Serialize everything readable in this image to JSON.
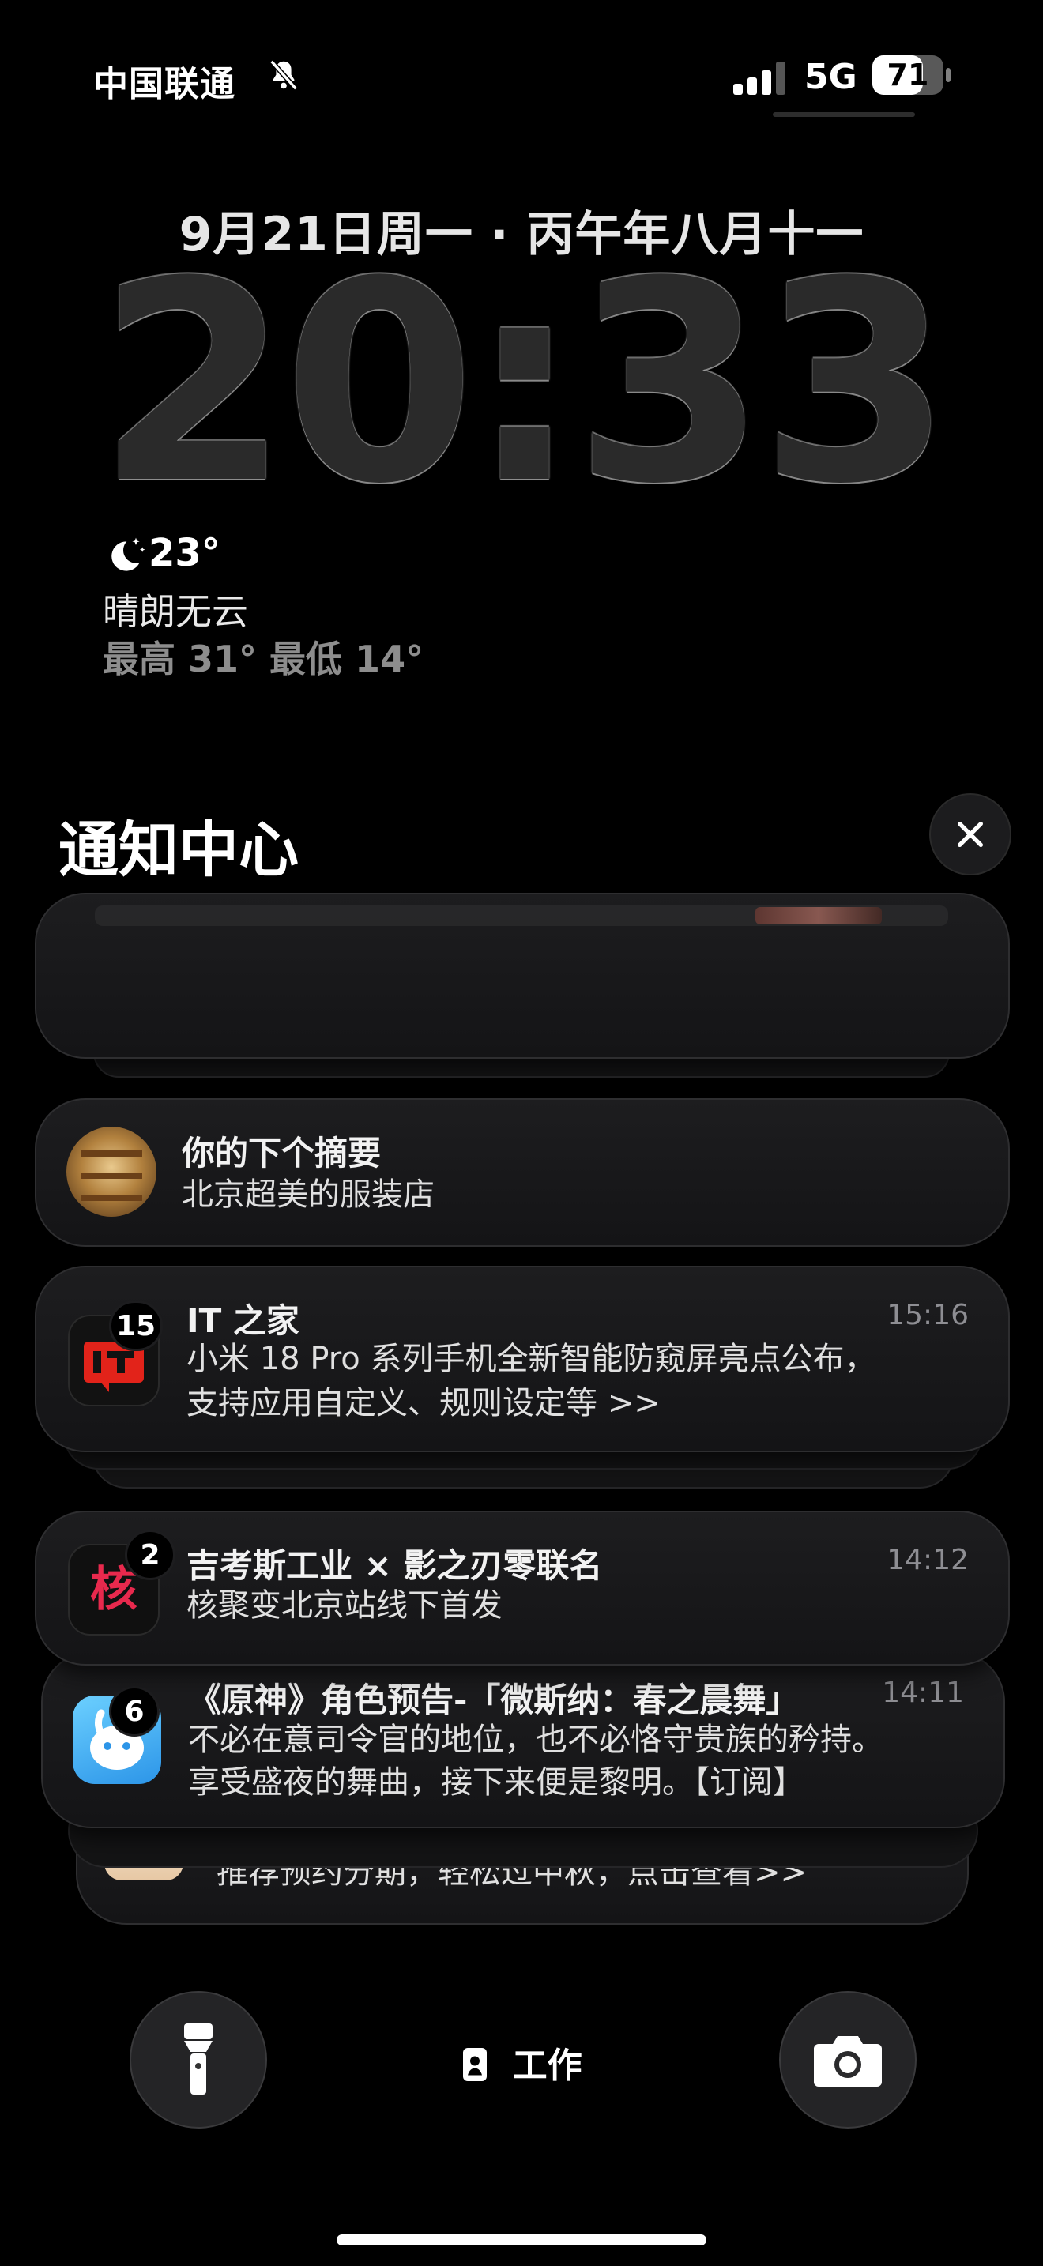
{
  "status": {
    "carrier": "中国联通",
    "network": "5G",
    "battery": "71"
  },
  "lockscreen": {
    "date": "9月21日周一 · 丙午年八月十一",
    "time": "20:33",
    "weather": {
      "temp": "23°",
      "condition": "晴朗无云",
      "range": "最高 31° 最低 14°"
    }
  },
  "notification_center": {
    "title": "通知中心",
    "notifications": [
      {
        "title": "你的下个摘要",
        "body": "北京超美的服装店"
      },
      {
        "app": "IT 之家",
        "badge": "15",
        "time": "15:16",
        "body_line1": "小米 18 Pro 系列手机全新智能防窥屏亮点公布，",
        "body_line2": "支持应用自定义、规则设定等 >>"
      },
      {
        "title": "吉考斯工业 × 影之刃零联名",
        "badge": "2",
        "time": "14:12",
        "body": "核聚变北京站线下首发"
      },
      {
        "title": "《原神》角色预告-「微斯纳：春之晨舞」",
        "badge": "6",
        "time": "14:11",
        "body_line1": "不必在意司令官的地位，也不必恪守贵族的矜持。",
        "body_line2": "享受盛夜的舞曲，接下来便是黎明。【订阅】"
      },
      {
        "body": "推荐预约分期，轻松过中秋，点击查看>>"
      }
    ]
  },
  "bottom": {
    "focus_label": "工作"
  },
  "colors": {
    "background": "#000000",
    "card": "#1a1a1c",
    "secondary_text": "#8e8e93",
    "itzhijia_red": "#e2231a",
    "kuchi_red": "#e8294d",
    "mihoyo_blue": "#3fb6f5"
  }
}
